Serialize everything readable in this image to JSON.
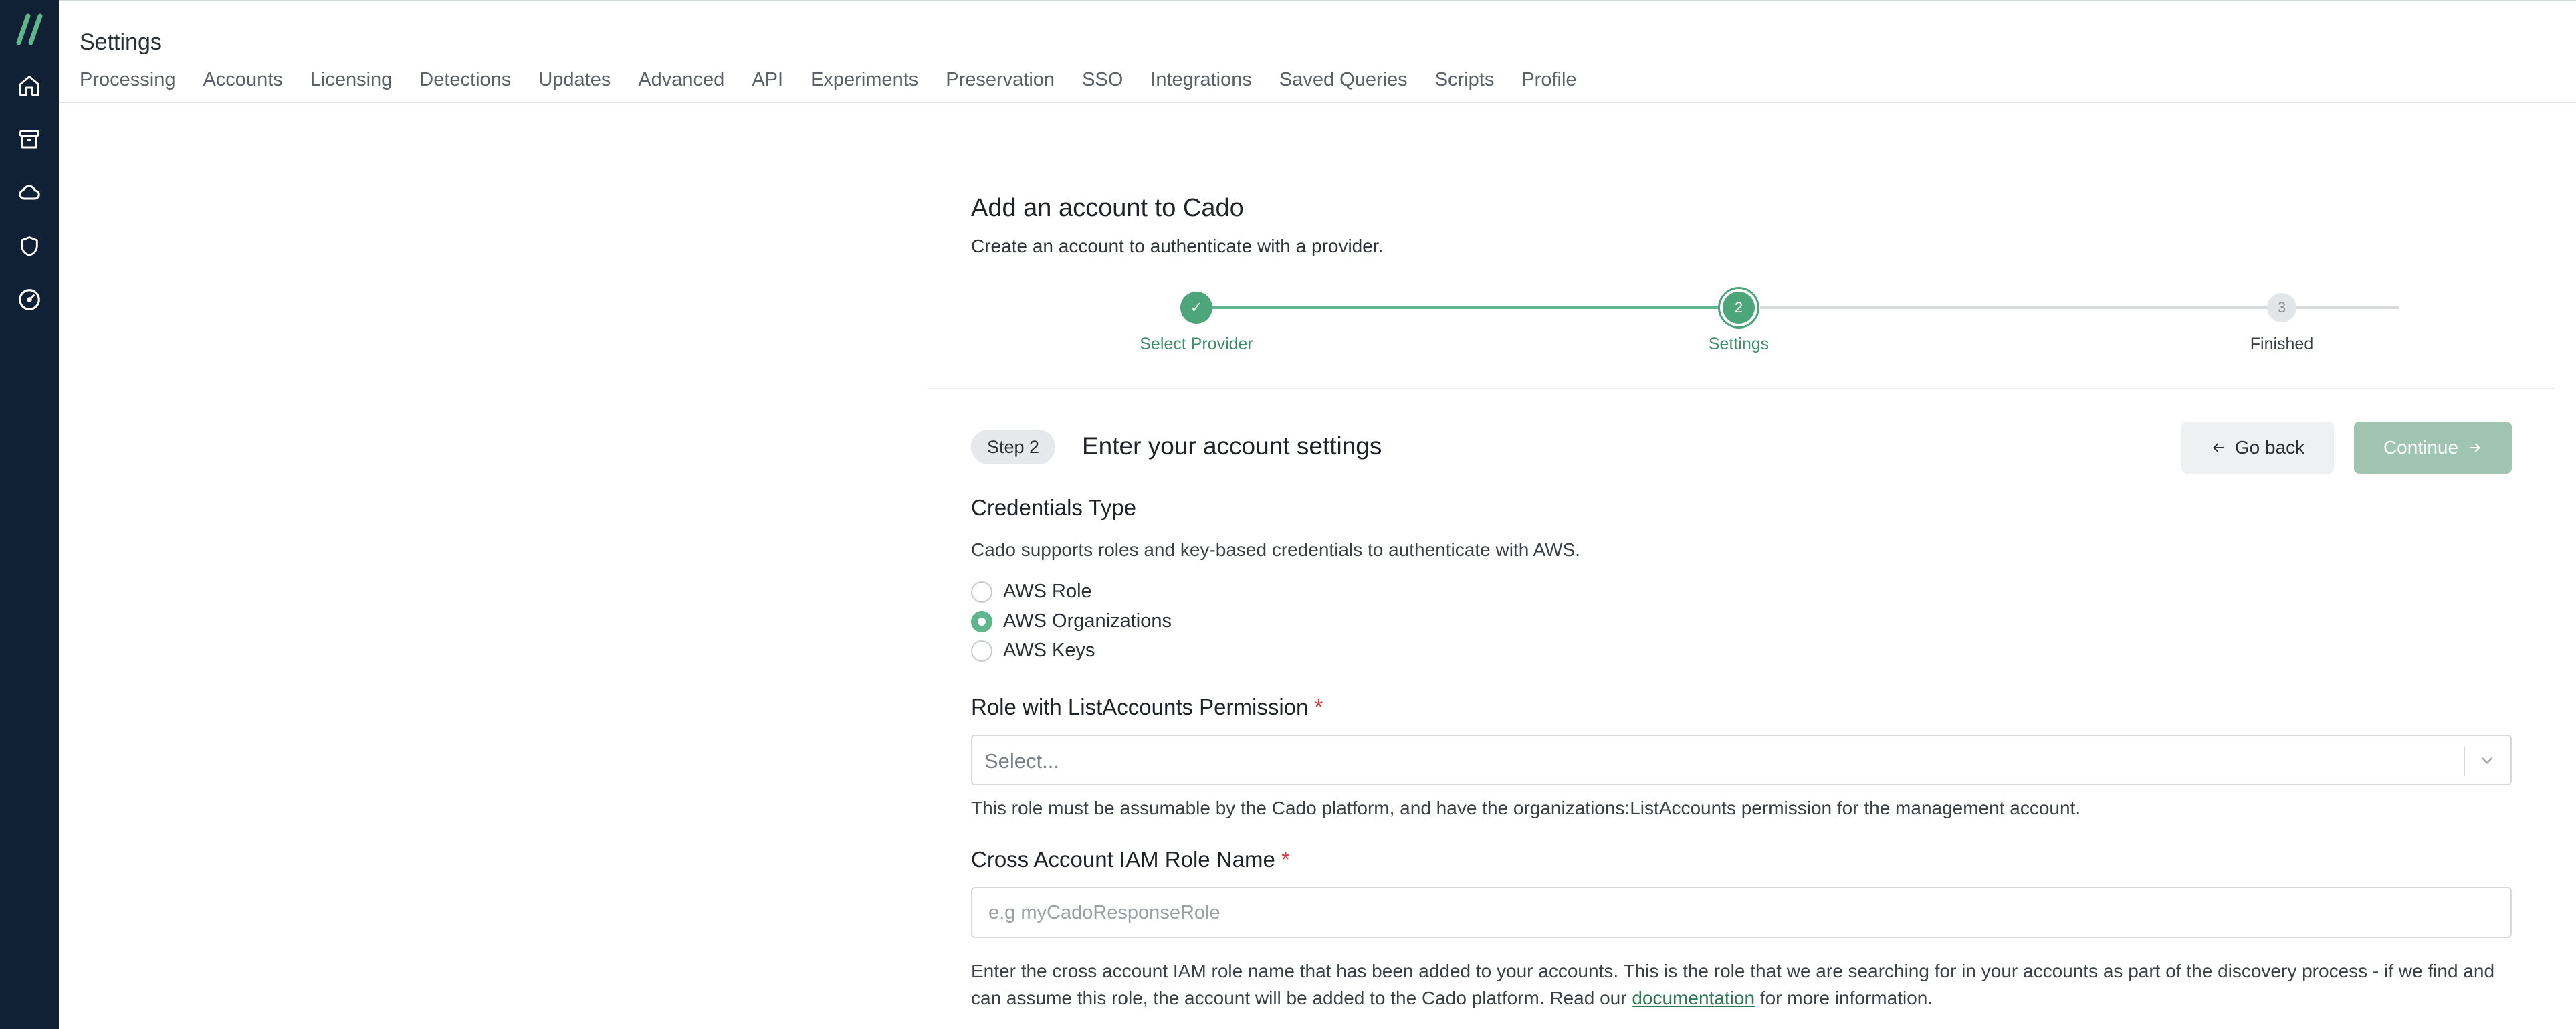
{
  "header": {
    "title": "Settings",
    "tabs": [
      "Processing",
      "Accounts",
      "Licensing",
      "Detections",
      "Updates",
      "Advanced",
      "API",
      "Experiments",
      "Preservation",
      "SSO",
      "Integrations",
      "Saved Queries",
      "Scripts",
      "Profile"
    ]
  },
  "sidebar": {
    "icons": [
      "home-icon",
      "archive-icon",
      "cloud-icon",
      "shield-icon",
      "gauge-icon"
    ]
  },
  "page": {
    "title": "Add an account to Cado",
    "subtitle": "Create an account to authenticate with a provider."
  },
  "stepper": {
    "steps": [
      {
        "label": "Select Provider",
        "marker": "✓",
        "state": "done"
      },
      {
        "label": "Settings",
        "marker": "2",
        "state": "current"
      },
      {
        "label": "Finished",
        "marker": "3",
        "state": "pending"
      }
    ]
  },
  "step": {
    "badge": "Step 2",
    "title": "Enter your account settings",
    "back_label": "Go back",
    "continue_label": "Continue"
  },
  "credentials": {
    "title": "Credentials Type",
    "description": "Cado supports roles and key-based credentials to authenticate with AWS.",
    "options": [
      "AWS Role",
      "AWS Organizations",
      "AWS Keys"
    ],
    "selected": "AWS Organizations"
  },
  "role_field": {
    "label": "Role with ListAccounts Permission",
    "required_mark": "*",
    "placeholder": "Select...",
    "help": "This role must be assumable by the Cado platform, and have the organizations:ListAccounts permission for the management account."
  },
  "iam_field": {
    "label": "Cross Account IAM Role Name",
    "required_mark": "*",
    "placeholder": "e.g myCadoResponseRole",
    "value": "",
    "help_prefix": "Enter the cross account IAM role name that has been added to your accounts. This is the role that we are searching for in your accounts as part of the discovery process - if we find and can assume this role, the account will be added to the Cado platform. Read our",
    "help_link": "documentation",
    "help_suffix": "for more information."
  },
  "colors": {
    "sidebar_bg": "#102135",
    "accent_green": "#4ca67a",
    "continue_disabled": "#9fc4b2",
    "required_red": "#d23a3a"
  }
}
